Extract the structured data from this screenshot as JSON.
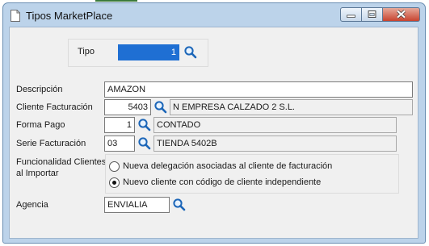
{
  "window": {
    "title": "Tipos MarketPlace",
    "icons": {
      "app": "document-icon",
      "minimize": "minimize-icon",
      "maximize": "maximize-icon",
      "close": "close-icon"
    }
  },
  "tipo": {
    "label": "Tipo",
    "value": "1"
  },
  "descripcion": {
    "label": "Descripción",
    "value": "AMAZON"
  },
  "cliente_facturacion": {
    "label": "Cliente Facturación",
    "code": "5403",
    "name": "N EMPRESA CALZADO 2 S.L."
  },
  "forma_pago": {
    "label": "Forma Pago",
    "code": "1",
    "name": "CONTADO"
  },
  "serie_facturacion": {
    "label": "Serie Facturación",
    "code": "03",
    "name": "TIENDA 5402B"
  },
  "funcionalidad": {
    "label_line1": "Funcionalidad Clientes",
    "label_line2": "al Importar",
    "options": [
      {
        "label": "Nueva delegación asociadas al cliente de facturación",
        "selected": false
      },
      {
        "label": "Nuevo cliente con código de cliente independiente",
        "selected": true
      }
    ]
  },
  "agencia": {
    "label": "Agencia",
    "value": "ENVIALIA"
  },
  "colors": {
    "window_frame": "#bcd3ea",
    "selection": "#1f6fd3",
    "close_button": "#c8432f",
    "lookup_icon": "#1c66b8"
  }
}
